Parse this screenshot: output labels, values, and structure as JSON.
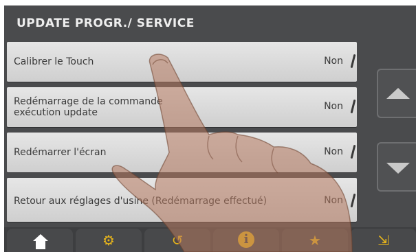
{
  "header": {
    "title": "UPDATE PROGR./ SERVICE"
  },
  "rows": [
    {
      "label": "Calibrer le Touch",
      "value": "Non"
    },
    {
      "label": "Redémarrage de la commande\nexécution update",
      "value": "Non"
    },
    {
      "label": "Redémarrer l'écran",
      "value": "Non"
    },
    {
      "label": "Retour aux réglages d'usine (Redémarrage effectué)",
      "value": "Non"
    }
  ],
  "scroll": {
    "up_icon": "triangle-up-icon",
    "down_icon": "triangle-down-icon"
  },
  "nav": {
    "items": [
      {
        "name": "home",
        "icon": "home-icon"
      },
      {
        "name": "settings",
        "icon": "gears-icon"
      },
      {
        "name": "back",
        "icon": "undo-arrow-icon"
      },
      {
        "name": "info",
        "icon": "info-icon"
      },
      {
        "name": "favorites",
        "icon": "list-star-icon"
      },
      {
        "name": "transfer",
        "icon": "screen-transfer-icon"
      }
    ]
  },
  "colors": {
    "background": "#4a4b4d",
    "row": "#dcdcdc",
    "accent_yellow": "#e7b51b",
    "text_dark": "#3a3a3a"
  }
}
